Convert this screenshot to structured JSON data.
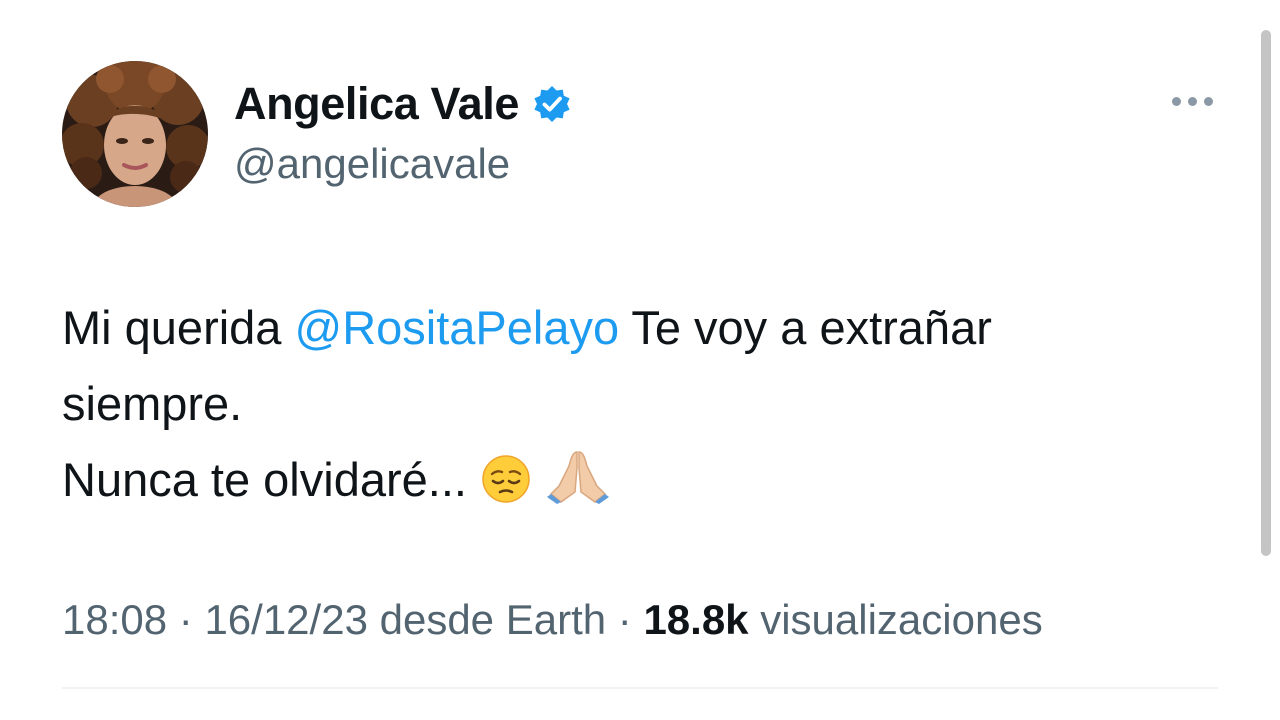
{
  "author": {
    "display_name": "Angelica Vale",
    "handle": "@angelicavale",
    "verified": true,
    "avatar_icon": "profile-photo"
  },
  "tweet": {
    "text_before_mention": "Mi querida ",
    "mention": "@RositaPelayo",
    "text_after_mention": " Te voy a extrañar",
    "line2": "siempre.",
    "line3": "Nunca te olvidaré...",
    "emojis": [
      "pensive-face",
      "folded-hands"
    ]
  },
  "meta": {
    "time": "18:08",
    "separator": " · ",
    "date": "16/12/23",
    "source": " desde Earth",
    "views_count": "18.8k",
    "views_label": " visualizaciones"
  },
  "colors": {
    "accent": "#1d9bf0",
    "secondary_text": "#536471",
    "primary_text": "#0f1419"
  }
}
